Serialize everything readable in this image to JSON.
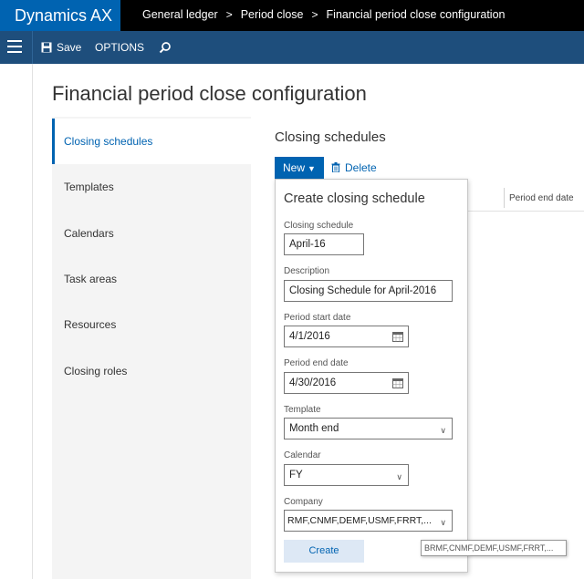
{
  "app": {
    "brand": "Dynamics AX"
  },
  "breadcrumb": [
    "General ledger",
    "Period close",
    "Financial period close configuration"
  ],
  "toolbar": {
    "save_label": "Save",
    "options_label": "OPTIONS"
  },
  "page": {
    "title": "Financial period close configuration"
  },
  "nav": {
    "items": [
      {
        "label": "Closing schedules"
      },
      {
        "label": "Templates"
      },
      {
        "label": "Calendars"
      },
      {
        "label": "Task areas"
      },
      {
        "label": "Resources"
      },
      {
        "label": "Closing roles"
      }
    ],
    "active": "Closing schedules"
  },
  "section": {
    "title": "Closing schedules",
    "new_label": "New",
    "delete_label": "Delete"
  },
  "grid": {
    "columns": [
      "Period end date"
    ]
  },
  "flyout": {
    "title": "Create closing schedule",
    "fields": {
      "closing_schedule": {
        "label": "Closing schedule",
        "value": "April-16"
      },
      "description": {
        "label": "Description",
        "value": "Closing Schedule for April-2016"
      },
      "period_start": {
        "label": "Period start date",
        "value": "4/1/2016"
      },
      "period_end": {
        "label": "Period end date",
        "value": "4/30/2016"
      },
      "template": {
        "label": "Template",
        "value": "Month end"
      },
      "calendar": {
        "label": "Calendar",
        "value": "FY"
      },
      "company": {
        "label": "Company",
        "value": "RMF,CNMF,DEMF,USMF,FRRT,..."
      }
    },
    "create_label": "Create"
  },
  "tooltip": {
    "text": "BRMF,CNMF,DEMF,USMF,FRRT,..."
  },
  "colors": {
    "brand": "#0063b1",
    "actionbar": "#1e4e7c",
    "topbar": "#000000",
    "nav_bg": "#f4f4f4"
  },
  "icons": {
    "menu": "hamburger-icon",
    "save": "save-icon",
    "search": "search-icon",
    "delete": "trash-icon",
    "date": "calendar-icon",
    "dropdown": "chevron-down-icon"
  }
}
